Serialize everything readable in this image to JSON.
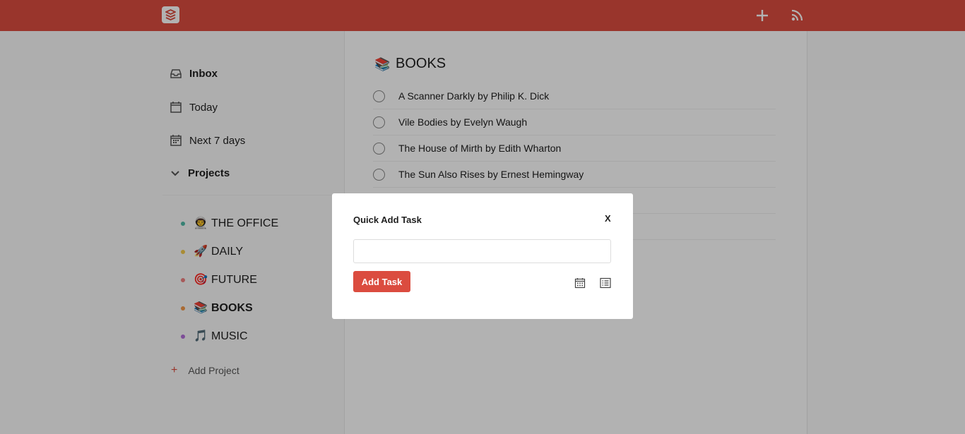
{
  "topbar": {
    "logo_icon": "todoist-logo-icon",
    "add_icon": "plus-icon",
    "feed_icon": "rss-icon",
    "color": "#db4c3f"
  },
  "sidebar": {
    "nav": [
      {
        "label": "Inbox",
        "icon": "inbox-icon"
      },
      {
        "label": "Today",
        "icon": "calendar-icon"
      },
      {
        "label": "Next 7 days",
        "icon": "calendar-week-icon"
      }
    ],
    "projects_label": "Projects",
    "projects": [
      {
        "emoji": "👨‍🚀",
        "name": "THE OFFICE",
        "dot_color": "#4fb9a6"
      },
      {
        "emoji": "🚀",
        "name": "DAILY",
        "dot_color": "#f2c94c"
      },
      {
        "emoji": "🎯",
        "name": "FUTURE",
        "dot_color": "#f08080"
      },
      {
        "emoji": "📚",
        "name": "BOOKS",
        "dot_color": "#f2994a"
      },
      {
        "emoji": "🎵",
        "name": "MUSIC",
        "dot_color": "#b46fd9"
      }
    ],
    "add_project": "Add Project"
  },
  "main": {
    "title_emoji": "📚",
    "title": "BOOKS",
    "tasks": [
      "A Scanner Darkly by Philip K. Dick",
      "Vile Bodies by Evelyn Waugh",
      "The House of Mirth by Edith Wharton",
      "The Sun Also Rises by Ernest Hemingway"
    ]
  },
  "modal": {
    "title": "Quick Add Task",
    "close": "X",
    "input_value": "",
    "add_button": "Add Task",
    "date_icon": "calendar-icon",
    "project_icon": "list-icon"
  }
}
